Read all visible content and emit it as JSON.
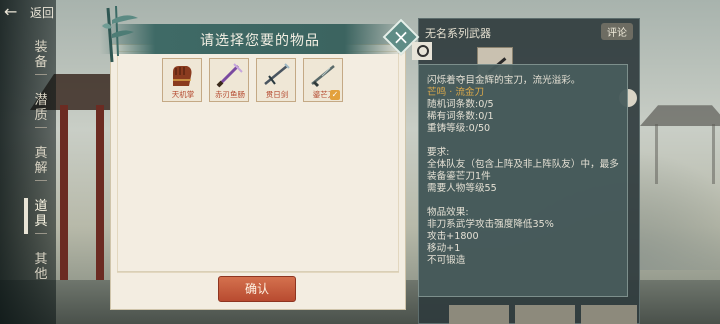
{
  "nav": {
    "back_label": "返回"
  },
  "sidebar": {
    "tabs": [
      {
        "label": [
          "装",
          "备"
        ]
      },
      {
        "label": [
          "潜",
          "质"
        ]
      },
      {
        "label": [
          "真",
          "解"
        ]
      },
      {
        "label": [
          "道",
          "具"
        ]
      },
      {
        "label": [
          "其",
          "他"
        ]
      }
    ]
  },
  "right_panel": {
    "title": "无名系列武器",
    "review_label": "评论"
  },
  "tooltip": {
    "desc": "闪烁着夺目金辉的宝刀，流光溢彩。",
    "desc_highlight": "芒鸣 · 流金刀",
    "stats": [
      "随机词条数:0/5",
      "稀有词条数:0/1",
      "重铸等级:0/50"
    ],
    "req_title": "要求:",
    "req_text": "全体队友（包含上阵及非上阵队友）中，最多装备鎏芒刀1件",
    "req_level": "需要人物等级55",
    "effect_title": "物品效果:",
    "effects": [
      "非刀系武学攻击强度降低35%",
      "攻击+1800",
      "移动+1",
      "不可锻造"
    ]
  },
  "dialog": {
    "title": "请选择您要的物品",
    "confirm_label": "确认",
    "items": [
      {
        "name": "天机掌",
        "selected": false
      },
      {
        "name": "赤刃鱼肠",
        "selected": false
      },
      {
        "name": "贯日剑",
        "selected": false
      },
      {
        "name": "鎏芒刀",
        "selected": true
      }
    ]
  }
}
